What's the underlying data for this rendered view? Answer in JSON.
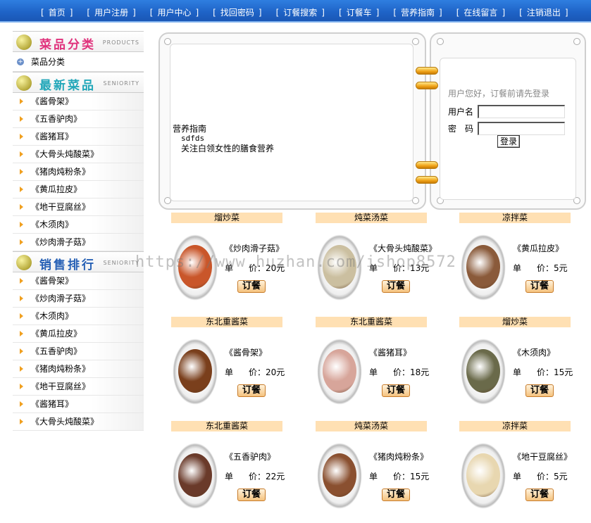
{
  "nav": {
    "items": [
      "首页",
      "用户注册",
      "用户中心",
      "找回密码",
      "订餐搜索",
      "订餐车",
      "营养指南",
      "在线留言",
      "注销退出"
    ]
  },
  "sidebar": {
    "categories": {
      "title": "菜品分类",
      "en": "PRODUCTS",
      "items": [
        "菜品分类"
      ]
    },
    "newest": {
      "title": "最新菜品",
      "en": "SENIORITY",
      "items": [
        "《酱骨架》",
        "《五香驴肉》",
        "《酱猪耳》",
        "《大骨头炖酸菜》",
        "《猪肉炖粉条》",
        "《黄瓜拉皮》",
        "《地干豆腐丝》",
        "《木须肉》",
        "《炒肉滑子菇》"
      ]
    },
    "sales": {
      "title": "销售排行",
      "en": "SENIORITY",
      "items": [
        "《酱骨架》",
        "《炒肉滑子菇》",
        "《木须肉》",
        "《黄瓜拉皮》",
        "《五香驴肉》",
        "《猪肉炖粉条》",
        "《地干豆腐丝》",
        "《酱猪耳》",
        "《大骨头炖酸菜》"
      ]
    }
  },
  "guide": {
    "title": "营养指南",
    "line1": "sdfds",
    "line2": "关注白领女性的膳食营养"
  },
  "login": {
    "hint": "用户您好，订餐前请先登录",
    "username_label": "用户名",
    "password_label": "密　码",
    "button": "登录"
  },
  "dishes": [
    {
      "category": "熘炒菜",
      "name": "《炒肉滑子菇》",
      "price_label": "单",
      "price_label2": "价：",
      "price": "20元",
      "order": "订餐",
      "color": "#c9562a"
    },
    {
      "category": "炖菜汤菜",
      "name": "《大骨头炖酸菜》",
      "price_label": "单",
      "price_label2": "价：",
      "price": "13元",
      "order": "订餐",
      "color": "#cbbfa0"
    },
    {
      "category": "凉拌菜",
      "name": "《黄瓜拉皮》",
      "price_label": "单",
      "price_label2": "价：",
      "price": "5元",
      "order": "订餐",
      "color": "#8a5a3a"
    },
    {
      "category": "东北重酱菜",
      "name": "《酱骨架》",
      "price_label": "单",
      "price_label2": "价：",
      "price": "20元",
      "order": "订餐",
      "color": "#7a3f1c"
    },
    {
      "category": "东北重酱菜",
      "name": "《酱猪耳》",
      "price_label": "单",
      "price_label2": "价：",
      "price": "18元",
      "order": "订餐",
      "color": "#d7a59a"
    },
    {
      "category": "熘炒菜",
      "name": "《木须肉》",
      "price_label": "单",
      "price_label2": "价：",
      "price": "15元",
      "order": "订餐",
      "color": "#6a6a4a"
    },
    {
      "category": "东北重酱菜",
      "name": "《五香驴肉》",
      "price_label": "单",
      "price_label2": "价：",
      "price": "22元",
      "order": "订餐",
      "color": "#6a3a2a"
    },
    {
      "category": "炖菜汤菜",
      "name": "《猪肉炖粉条》",
      "price_label": "单",
      "price_label2": "价：",
      "price": "15元",
      "order": "订餐",
      "color": "#8a5030"
    },
    {
      "category": "凉拌菜",
      "name": "《地干豆腐丝》",
      "price_label": "单",
      "price_label2": "价：",
      "price": "5元",
      "order": "订餐",
      "color": "#e8d7b0"
    }
  ],
  "watermark": "https://www.huzhan.com/ishop8572"
}
